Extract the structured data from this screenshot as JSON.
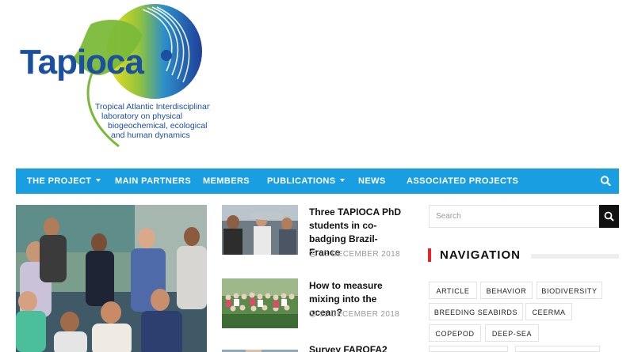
{
  "logo": {
    "name": "Tapioca",
    "tagline_lines": [
      "Tropical Atlantic Interdisciplinary",
      "laboratory on physical",
      "biogeochemical, ecological",
      "and human dynamics"
    ]
  },
  "nav": {
    "items": [
      {
        "label": "THE PROJECT"
      },
      {
        "label": "MAIN PARTNERS"
      },
      {
        "label": "MEMBERS"
      },
      {
        "label": "PUBLICATIONS"
      },
      {
        "label": "NEWS"
      },
      {
        "label": "ASSOCIATED PROJECTS"
      }
    ],
    "search_icon": "search-icon"
  },
  "posts": [
    {
      "title": "Three TAPIOCA PhD students in co-badging Brazil-France",
      "date": "13 DECEMBER 2018"
    },
    {
      "title": "How to measure mixing into the ocean?",
      "date": "11 DECEMBER 2018"
    },
    {
      "title": "Survey FAROFA2"
    }
  ],
  "sidebar": {
    "search_placeholder": "Search",
    "navigation_heading": "NAVIGATION",
    "tags": [
      "ARTICLE",
      "BEHAVIOR",
      "BIODIVERSITY",
      "BREEDING SEABIRDS",
      "CEERMA",
      "COPEPOD",
      "DEEP-SEA"
    ]
  },
  "colors": {
    "nav_bg": "#1a9ee2",
    "heading_accent": "#e3262d",
    "logo_blue": "#1b4fa0",
    "logo_green": "#7bb93a"
  }
}
